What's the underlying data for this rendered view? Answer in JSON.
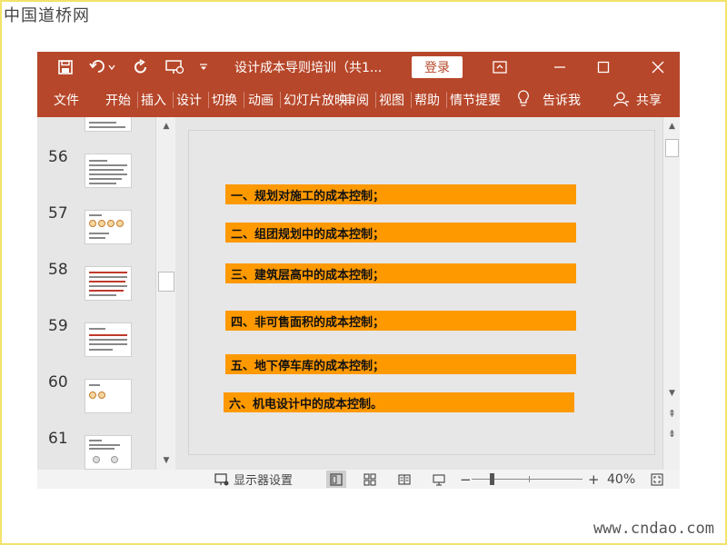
{
  "watermark": {
    "top": "中国道桥网",
    "bottom": "www.cndao.com"
  },
  "titlebar": {
    "document_title": "设计成本导则培训（共1...",
    "login_label": "登录",
    "icons": [
      "save-icon",
      "undo-icon",
      "redo-icon",
      "present-icon",
      "customize-qat-icon",
      "ribbon-display-icon",
      "minimize-icon",
      "maximize-icon",
      "close-icon"
    ]
  },
  "ribbon": {
    "tabs": [
      {
        "label": "文件"
      },
      {
        "label": "开始"
      },
      {
        "label": "插入"
      },
      {
        "label": "设计"
      },
      {
        "label": "切换"
      },
      {
        "label": "动画"
      },
      {
        "label": "幻灯片放映"
      },
      {
        "label": "审阅"
      },
      {
        "label": "视图"
      },
      {
        "label": "帮助"
      },
      {
        "label": "情节提要"
      }
    ],
    "tell_me": "告诉我",
    "share": "共享"
  },
  "thumbnails": {
    "slides": [
      {
        "number": "56"
      },
      {
        "number": "57"
      },
      {
        "number": "58"
      },
      {
        "number": "59"
      },
      {
        "number": "60"
      },
      {
        "number": "61"
      }
    ]
  },
  "slide": {
    "items": [
      {
        "text": "一、规划对施工的成本控制；"
      },
      {
        "text": "二、组团规划中的成本控制；"
      },
      {
        "text": "三、建筑层高中的成本控制；"
      },
      {
        "text": "四、非可售面积的成本控制；"
      },
      {
        "text": "五、地下停车库的成本控制；"
      },
      {
        "text": "六、机电设计中的成本控制。"
      }
    ],
    "bar_color": "#ff9900"
  },
  "statusbar": {
    "display_settings": "显示器设置",
    "zoom_minus": "−",
    "zoom_plus": "+",
    "zoom_level": "40%"
  },
  "colors": {
    "accent": "#b7472a",
    "workspace": "#e6e6e6"
  }
}
